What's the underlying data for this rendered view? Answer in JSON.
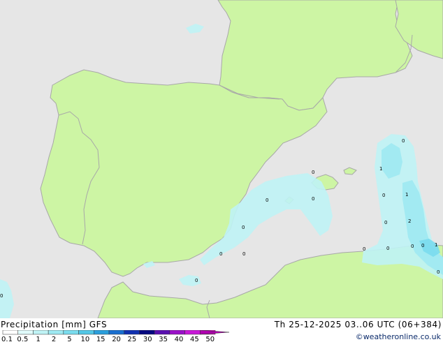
{
  "map": {
    "colors": {
      "sea": "#e6e6e6",
      "land": "#cdf5a4",
      "coast": "#a8a8a8",
      "border": "#a8a8a8"
    },
    "value_labels": [
      "0",
      "0",
      "0",
      "1",
      "0",
      "1",
      "0",
      "2",
      "0",
      "0",
      "0",
      "1",
      "0",
      "0",
      "0",
      "0",
      "0",
      "0",
      "0",
      "0"
    ]
  },
  "footer": {
    "title": "Precipitation [mm]  GFS",
    "datetime": "Th 25-12-2025 03..06 UTC (06+384)",
    "credit": "©weatheronline.co.uk"
  },
  "legend": {
    "labels": [
      "0.1",
      "0.5",
      "1",
      "2",
      "5",
      "10",
      "15",
      "20",
      "25",
      "30",
      "35",
      "40",
      "45",
      "50"
    ],
    "colors": [
      "#ffffff",
      "#e0fbfb",
      "#bff3f5",
      "#9ee9f2",
      "#7adcee",
      "#52c7e6",
      "#2a9fdc",
      "#1a6fd0",
      "#1030b0",
      "#060880",
      "#5a10b0",
      "#9a10c8",
      "#c818d8",
      "#e020c8",
      "#b000b0"
    ]
  }
}
